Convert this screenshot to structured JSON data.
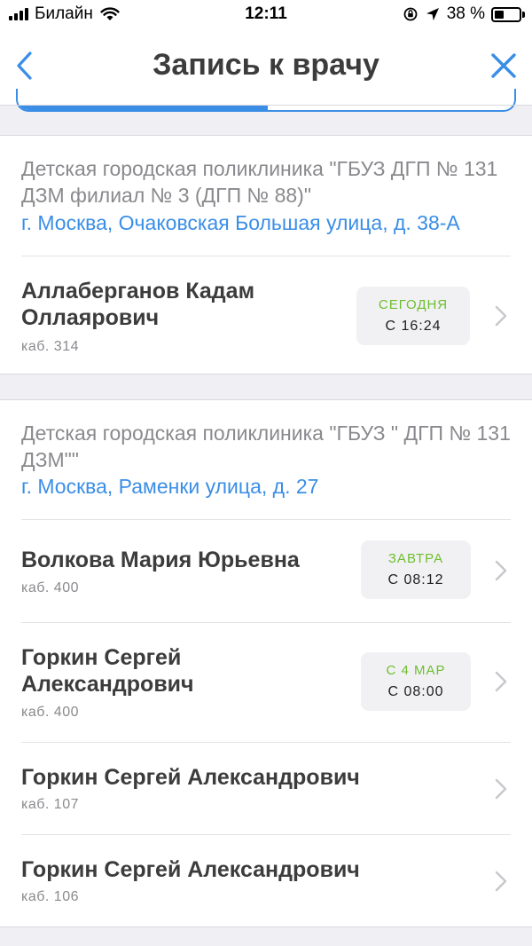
{
  "status_bar": {
    "carrier": "Билайн",
    "time": "12:11",
    "battery": "38 %",
    "battery_level": 0.38
  },
  "nav": {
    "title": "Запись к врачу",
    "back_icon": "chevron-left-icon",
    "close_icon": "close-icon",
    "accent": "#3a8ee6"
  },
  "clinics": [
    {
      "name": "Детская городская поликлиника \"ГБУЗ ДГП № 131 ДЗМ филиал № 3 (ДГП № 88)\"",
      "address": "г. Москва, Очаковская Большая улица, д. 38-А",
      "doctors": [
        {
          "name": "Аллаберганов Кадам Оллаярович",
          "cabinet": "каб. 314",
          "slot_day": "СЕГОДНЯ",
          "slot_time": "С 16:24"
        }
      ]
    },
    {
      "name": "Детская городская поликлиника \"ГБУЗ \" ДГП № 131 ДЗМ\"\"",
      "address": "г. Москва, Раменки улица, д. 27",
      "doctors": [
        {
          "name": "Волкова Мария Юрьевна",
          "cabinet": "каб. 400",
          "slot_day": "ЗАВТРА",
          "slot_time": "С 08:12"
        },
        {
          "name": "Горкин Сергей Александрович",
          "cabinet": "каб. 400",
          "slot_day": "С 4 МАР",
          "slot_time": "С 08:00"
        },
        {
          "name": "Горкин Сергей Александрович",
          "cabinet": "каб. 107"
        },
        {
          "name": "Горкин Сергей Александрович",
          "cabinet": "каб. 106"
        }
      ]
    }
  ],
  "colors": {
    "slot_day": "#6cbf2e",
    "link": "#3a8ee6",
    "background": "#efeff4"
  }
}
